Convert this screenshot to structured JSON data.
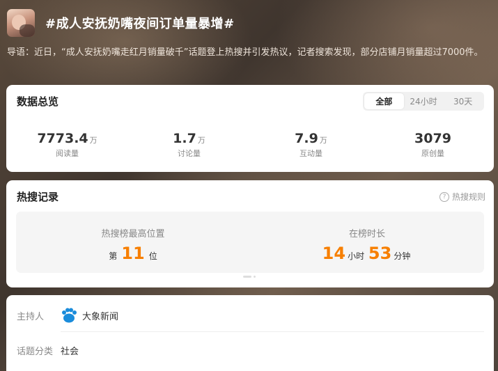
{
  "header": {
    "title": "#成人安抚奶嘴夜间订单量暴增#",
    "intro": "导语：近日，“成人安抚奶嘴走红月销量破千”话题登上热搜并引发热议，记者搜索发现，部分店铺月销量超过7000件。"
  },
  "overview": {
    "title": "数据总览",
    "tabs": [
      "全部",
      "24小时",
      "30天"
    ],
    "active_tab": "全部",
    "stats": [
      {
        "value": "7773.4",
        "unit": "万",
        "label": "阅读量"
      },
      {
        "value": "1.7",
        "unit": "万",
        "label": "讨论量"
      },
      {
        "value": "7.9",
        "unit": "万",
        "label": "互动量"
      },
      {
        "value": "3079",
        "unit": "",
        "label": "原创量"
      }
    ]
  },
  "hot": {
    "title": "热搜记录",
    "rules_label": "热搜规则",
    "rank_label": "热搜榜最高位置",
    "rank_prefix": "第",
    "rank_value": "11",
    "rank_suffix": "位",
    "duration_label": "在榜时长",
    "hours": "14",
    "hours_unit": "小时",
    "minutes": "53",
    "minutes_unit": "分钟"
  },
  "info": {
    "host_label": "主持人",
    "host_name": "大象新闻",
    "category_label": "话题分类",
    "category_value": "社会"
  },
  "icons": {
    "help": "question-circle-icon",
    "host": "paw-logo-icon"
  },
  "colors": {
    "accent": "#f77f00",
    "host_logo": "#1a8cdb"
  }
}
